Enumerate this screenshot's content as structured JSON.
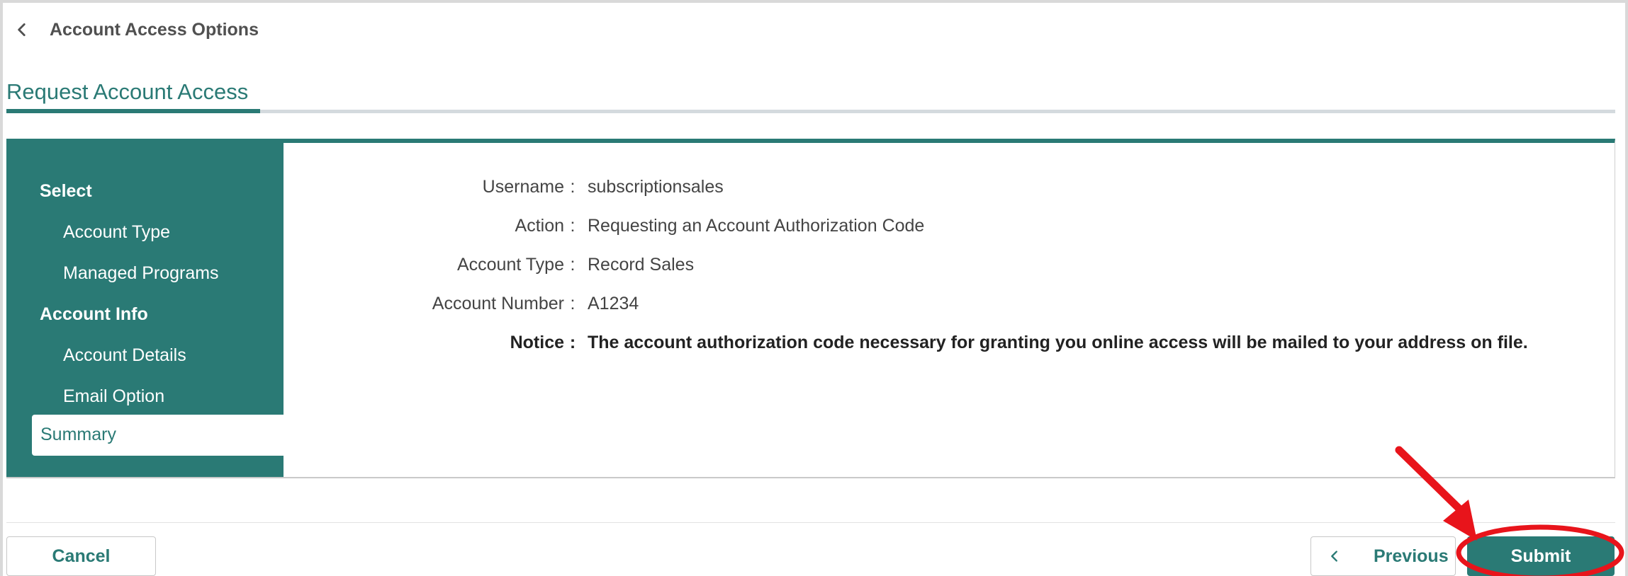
{
  "nav": {
    "back_label": "Account Access Options"
  },
  "page": {
    "title": "Request Account Access"
  },
  "sidebar": {
    "groups": [
      {
        "label": "Select",
        "items": [
          "Account Type",
          "Managed Programs"
        ]
      },
      {
        "label": "Account Info",
        "items": [
          "Account Details",
          "Email Option"
        ]
      }
    ],
    "active_item": "Summary"
  },
  "summary": {
    "rows": [
      {
        "label": "Username",
        "value": "subscriptionsales"
      },
      {
        "label": "Action",
        "value": "Requesting an Account Authorization Code"
      },
      {
        "label": "Account Type",
        "value": "Record Sales"
      },
      {
        "label": "Account Number",
        "value": "A1234"
      },
      {
        "label": "Notice",
        "value": "The account authorization code necessary for granting you online access will be mailed to your address on file."
      }
    ],
    "separator": ":"
  },
  "buttons": {
    "cancel": "Cancel",
    "previous": "Previous",
    "submit": "Submit"
  },
  "colors": {
    "accent": "#2a7a75",
    "annotation": "#e8141b"
  }
}
